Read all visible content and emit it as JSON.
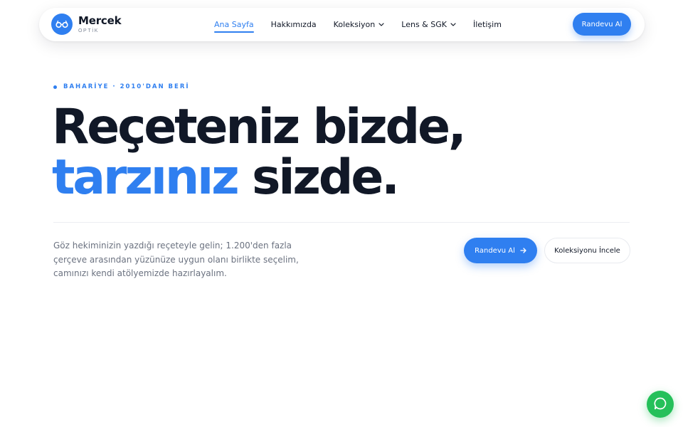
{
  "brand": {
    "name": "Mercek",
    "tagline": "OPTİK",
    "logo_icon": "glasses-icon"
  },
  "nav": {
    "items": [
      {
        "label": "Ana Sayfa",
        "active": true
      },
      {
        "label": "Hakkımızda",
        "active": false
      },
      {
        "label": "Koleksiyon",
        "active": false,
        "dropdown": true
      },
      {
        "label": "Lens & SGK",
        "active": false,
        "dropdown": true
      },
      {
        "label": "İletişim",
        "active": false
      }
    ],
    "cta_label": "Randevu Al"
  },
  "hero": {
    "eyebrow": "BAHARİYE · 2010'DAN BERİ",
    "headline_line1": "Reçeteniz bizde,",
    "headline_accent": "tarzınız",
    "headline_rest": " sizde.",
    "lede": "Göz hekiminizin yazdığı reçeteyle gelin; 1.200'den fazla çerçeve arasından yüzünüze uygun olanı birlikte seçelim, camınızı kendi atölyemizde hazırlayalım.",
    "primary_cta": "Randevu Al",
    "secondary_cta": "Koleksiyonu İncele"
  },
  "chat": {
    "icon": "chat-bubble-icon"
  },
  "colors": {
    "accent": "#2f7ff0",
    "text": "#111827",
    "muted": "#6b7280",
    "chat": "#25c05a"
  }
}
